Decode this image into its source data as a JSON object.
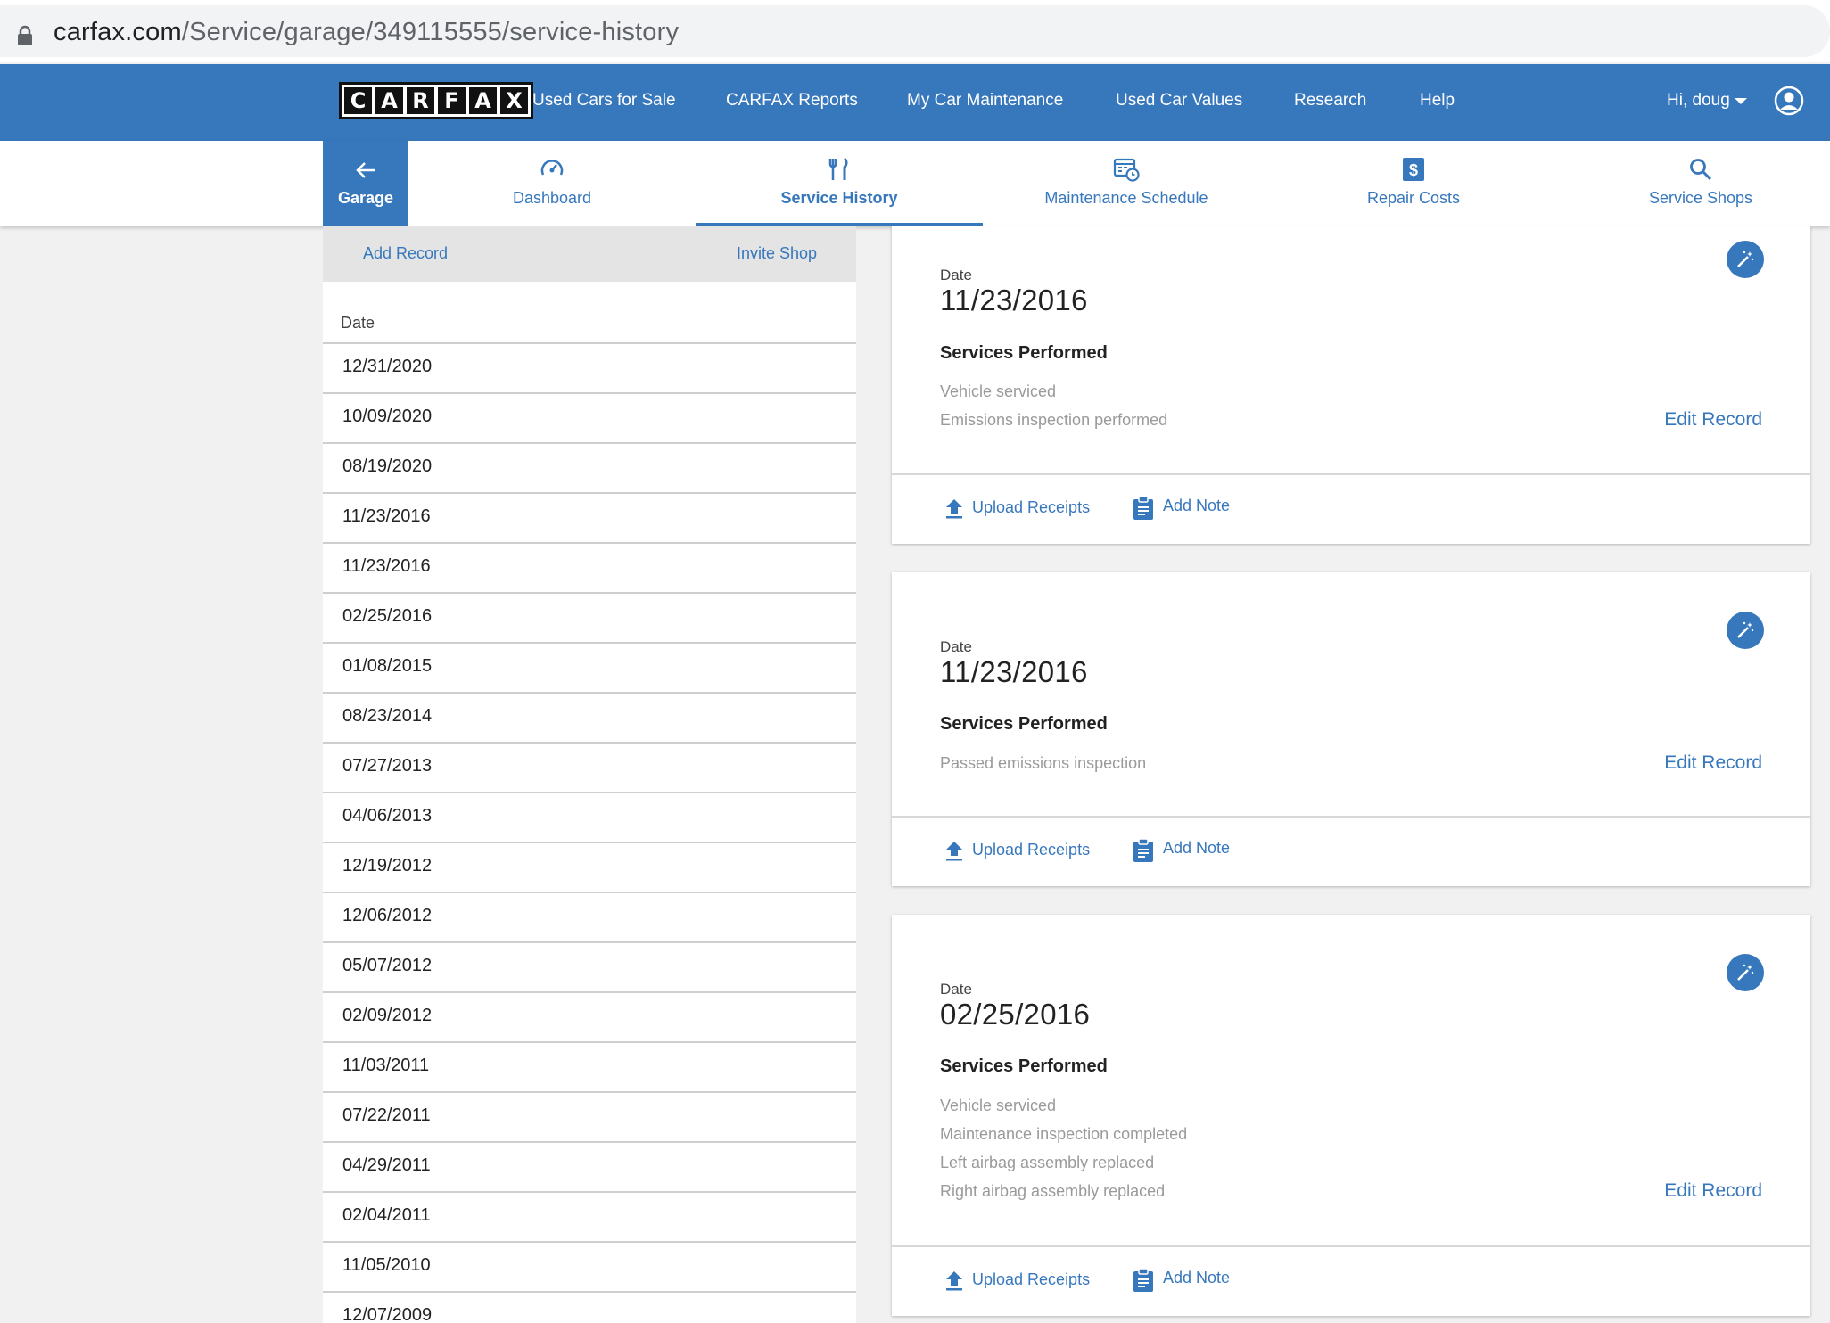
{
  "browser": {
    "url_domain": "carfax.com",
    "url_path": "/Service/garage/349115555/service-history"
  },
  "topnav": {
    "logo_letters": [
      "C",
      "A",
      "R",
      "F",
      "A",
      "X"
    ],
    "links": [
      "Used Cars for Sale",
      "CARFAX Reports",
      "My Car Maintenance",
      "Used Car Values",
      "Research",
      "Help"
    ],
    "greeting": "Hi, doug"
  },
  "tabs": {
    "back_label": "Garage",
    "items": [
      {
        "label": "Dashboard",
        "icon": "speedometer-icon"
      },
      {
        "label": "Service History",
        "icon": "wrench-fork-icon",
        "active": true
      },
      {
        "label": "Maintenance Schedule",
        "icon": "calendar-clock-icon"
      },
      {
        "label": "Repair Costs",
        "icon": "dollar-icon"
      },
      {
        "label": "Service Shops",
        "icon": "search-icon"
      }
    ]
  },
  "sidebar": {
    "add_record": "Add Record",
    "invite_shop": "Invite Shop",
    "date_header": "Date",
    "dates": [
      "12/31/2020",
      "10/09/2020",
      "08/19/2020",
      "11/23/2016",
      "11/23/2016",
      "02/25/2016",
      "01/08/2015",
      "08/23/2014",
      "07/27/2013",
      "04/06/2013",
      "12/19/2012",
      "12/06/2012",
      "05/07/2012",
      "02/09/2012",
      "11/03/2011",
      "07/22/2011",
      "04/29/2011",
      "02/04/2011",
      "11/05/2010",
      "12/07/2009"
    ]
  },
  "records": [
    {
      "date_label": "Date",
      "date": "11/23/2016",
      "services_label": "Services Performed",
      "services": [
        "Vehicle serviced",
        "Emissions inspection performed"
      ],
      "edit": "Edit Record",
      "upload": "Upload Receipts",
      "note": "Add Note"
    },
    {
      "date_label": "Date",
      "date": "11/23/2016",
      "services_label": "Services Performed",
      "services": [
        "Passed emissions inspection"
      ],
      "edit": "Edit Record",
      "upload": "Upload Receipts",
      "note": "Add Note"
    },
    {
      "date_label": "Date",
      "date": "02/25/2016",
      "services_label": "Services Performed",
      "services": [
        "Vehicle serviced",
        "Maintenance inspection completed",
        "Left airbag assembly replaced",
        "Right airbag assembly replaced"
      ],
      "edit": "Edit Record",
      "upload": "Upload Receipts",
      "note": "Add Note"
    }
  ],
  "colors": {
    "brand_blue": "#3777bc",
    "panel_gray": "#e4e4e4"
  }
}
